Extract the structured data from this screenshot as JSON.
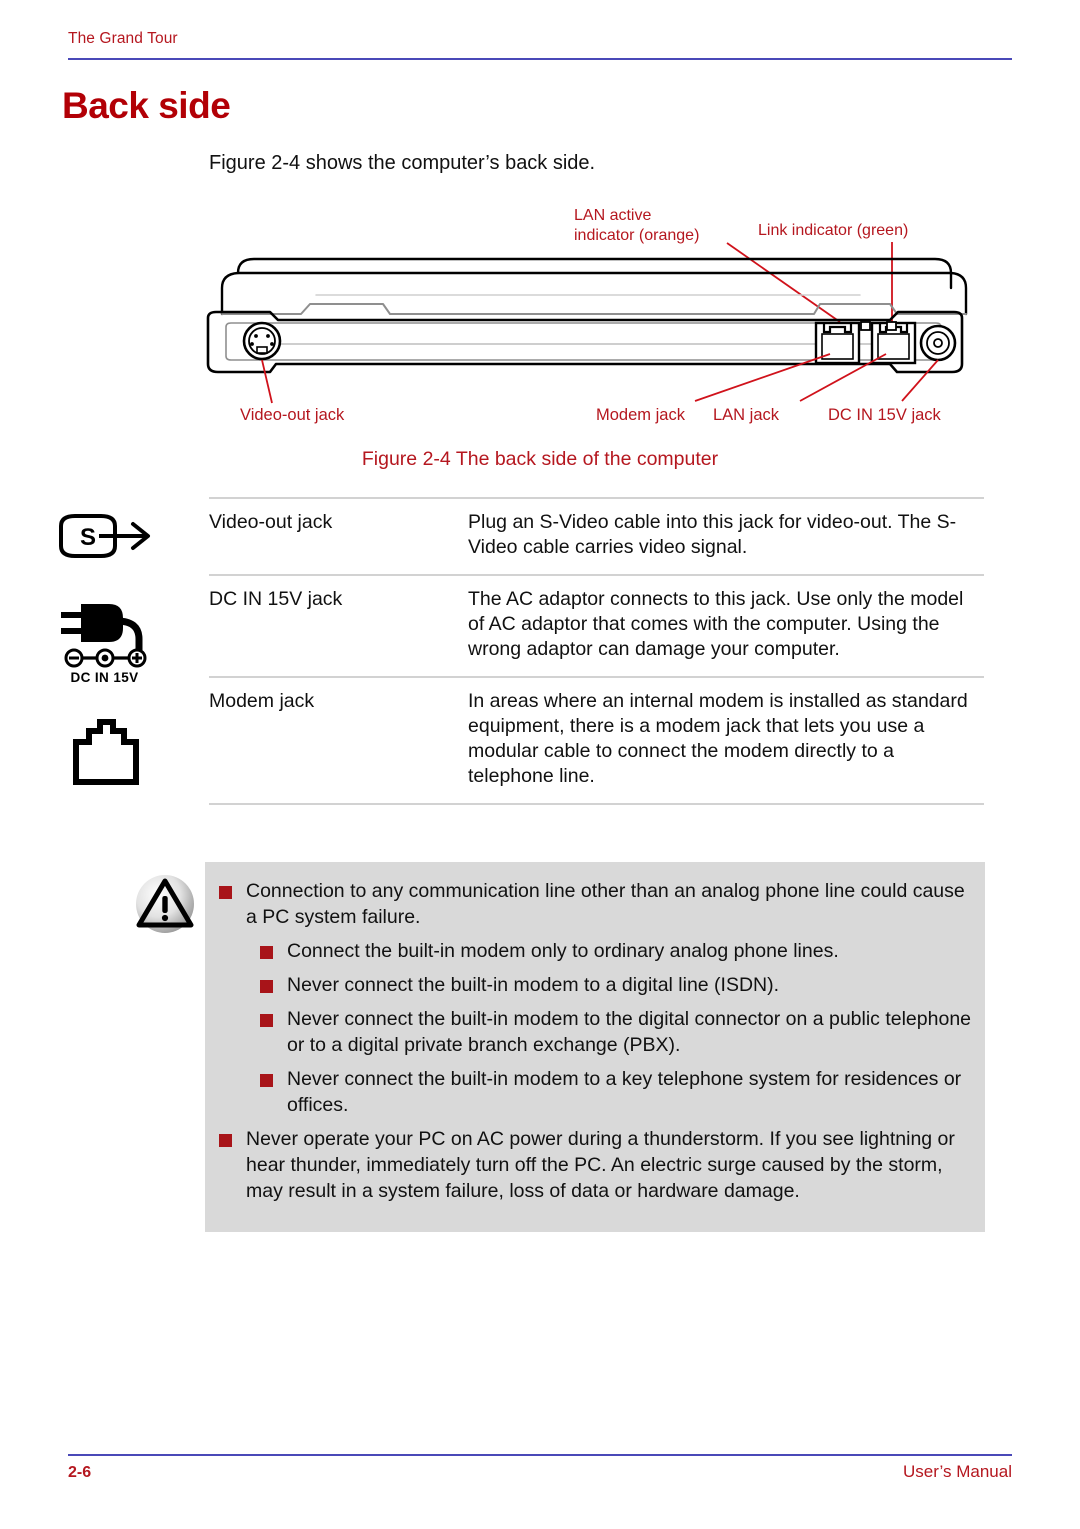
{
  "header": {
    "running_head": "The Grand Tour"
  },
  "title": "Back side",
  "intro": "Figure 2-4 shows the computer’s back side.",
  "figure": {
    "caption": "Figure 2-4 The back side of the computer",
    "callouts": {
      "lan_active_line1": "LAN active",
      "lan_active_line2": "indicator (orange)",
      "link_indicator": "Link indicator (green)",
      "video_out": "Video-out jack",
      "modem": "Modem jack",
      "lan": "LAN jack",
      "dc_in": "DC IN 15V jack"
    }
  },
  "spec_table": {
    "rows": [
      {
        "icon": "s-video-out-icon",
        "icon_label": "",
        "term": "Video-out jack",
        "desc": "Plug an S-Video cable into this jack for video-out. The S-Video cable carries video signal."
      },
      {
        "icon": "dc-in-plug-icon",
        "icon_label": "DC IN 15V",
        "term": "DC IN 15V jack",
        "desc": "The AC adaptor connects to this jack. Use only the model of AC adaptor that comes with the computer. Using the wrong adaptor can damage your computer."
      },
      {
        "icon": "modem-jack-icon",
        "icon_label": "",
        "term": "Modem jack",
        "desc": "In areas where an internal modem is installed as standard equipment, there is a modem jack that lets you use a modular cable to connect the modem directly to a telephone line."
      }
    ]
  },
  "caution": {
    "icon": "caution-triangle-icon",
    "items": [
      {
        "level": 0,
        "text": "Connection to any communication line other than an analog phone line could cause a PC system failure."
      },
      {
        "level": 1,
        "text": "Connect the built-in modem only to ordinary analog phone lines."
      },
      {
        "level": 1,
        "text": "Never connect the built-in modem to a digital line (ISDN)."
      },
      {
        "level": 1,
        "text": "Never connect the built-in modem to the digital connector on a public telephone or to a digital private branch exchange (PBX)."
      },
      {
        "level": 1,
        "text": "Never connect the built-in modem to a key telephone system for residences or offices."
      },
      {
        "level": 0,
        "text": "Never operate your PC on AC power during a thunderstorm. If you see lightning or hear thunder, immediately turn off the PC. An electric surge caused by the storm, may result in a system failure, loss of data or hardware damage."
      }
    ]
  },
  "footer": {
    "page_number": "2-6",
    "manual_label": "User’s Manual"
  },
  "colors": {
    "accent_red": "#B5171F",
    "title_red": "#B20006",
    "rule_blue": "#4A49B8",
    "bullet_red": "#A81419",
    "caution_bg": "#D9D9D9",
    "table_rule": "#D2D2D2"
  }
}
